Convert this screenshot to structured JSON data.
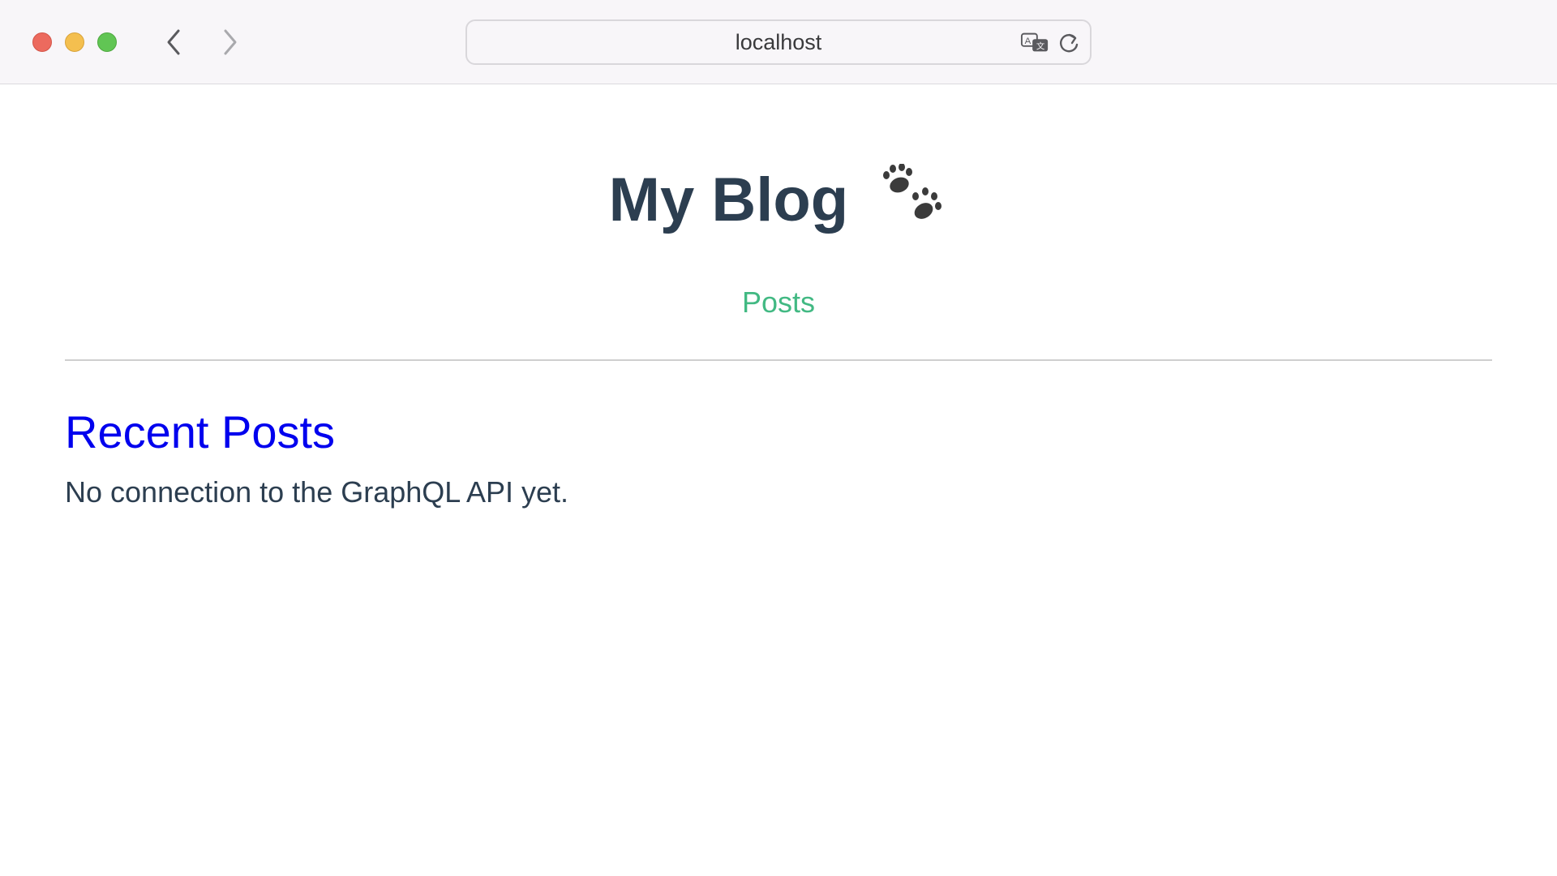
{
  "browser": {
    "url": "localhost",
    "colors": {
      "close": "#ec6a5e",
      "minimize": "#f4bf4f",
      "maximize": "#61c554"
    },
    "icons": [
      "back-icon",
      "forward-icon",
      "translate-icon",
      "reload-icon"
    ]
  },
  "page": {
    "title": "My Blog",
    "title_icon": "paw-prints-icon",
    "nav": {
      "posts_label": "Posts"
    },
    "section": {
      "title": "Recent Posts",
      "status": "No connection to the GraphQL API yet."
    },
    "colors": {
      "title": "#2c3e50",
      "nav_link": "#42b983",
      "section_link": "#0000ee"
    }
  }
}
